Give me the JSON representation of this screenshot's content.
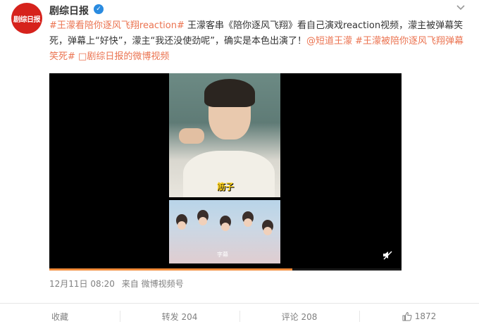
{
  "post": {
    "avatar_text": "剧综日报",
    "username": "剧综日报",
    "verified_mark": "✓",
    "segments": [
      {
        "text": "#王濛看陪你逐风飞翔reaction#",
        "type": "topic"
      },
      {
        "text": " 王濛客串《陪你逐风飞翔》看自己演戏reaction视频，濛主被弹幕笑死，弹幕上“好快”，濛主“我还没使劲呢”，确实是本色出演了！",
        "type": "text"
      },
      {
        "text": "@短道王濛",
        "type": "link"
      },
      {
        "text": " ",
        "type": "text"
      },
      {
        "text": "#王濛被陪你逐风飞翔弹幕笑死#",
        "type": "topic"
      },
      {
        "text": " ",
        "type": "text"
      },
      {
        "text": "□剧综日报的微博视频",
        "type": "link"
      }
    ],
    "video": {
      "top_caption": "筋子",
      "bottom_caption": "字幕",
      "progress": 0.69
    },
    "meta": {
      "date": "12月11日 08:20",
      "source": "来自 微博视频号"
    },
    "actions": {
      "favorite": "收藏",
      "repost": "转发 204",
      "comment": "评论 208",
      "like": "1872"
    }
  },
  "colors": {
    "topic": "#eb7350",
    "avatar_bg": "#d6221c",
    "verified": "#2a8be0",
    "progress": "#f28c3a"
  },
  "icons": [
    "chevron-down-icon",
    "verified-icon",
    "mute-icon",
    "like-icon",
    "video-link-icon"
  ]
}
